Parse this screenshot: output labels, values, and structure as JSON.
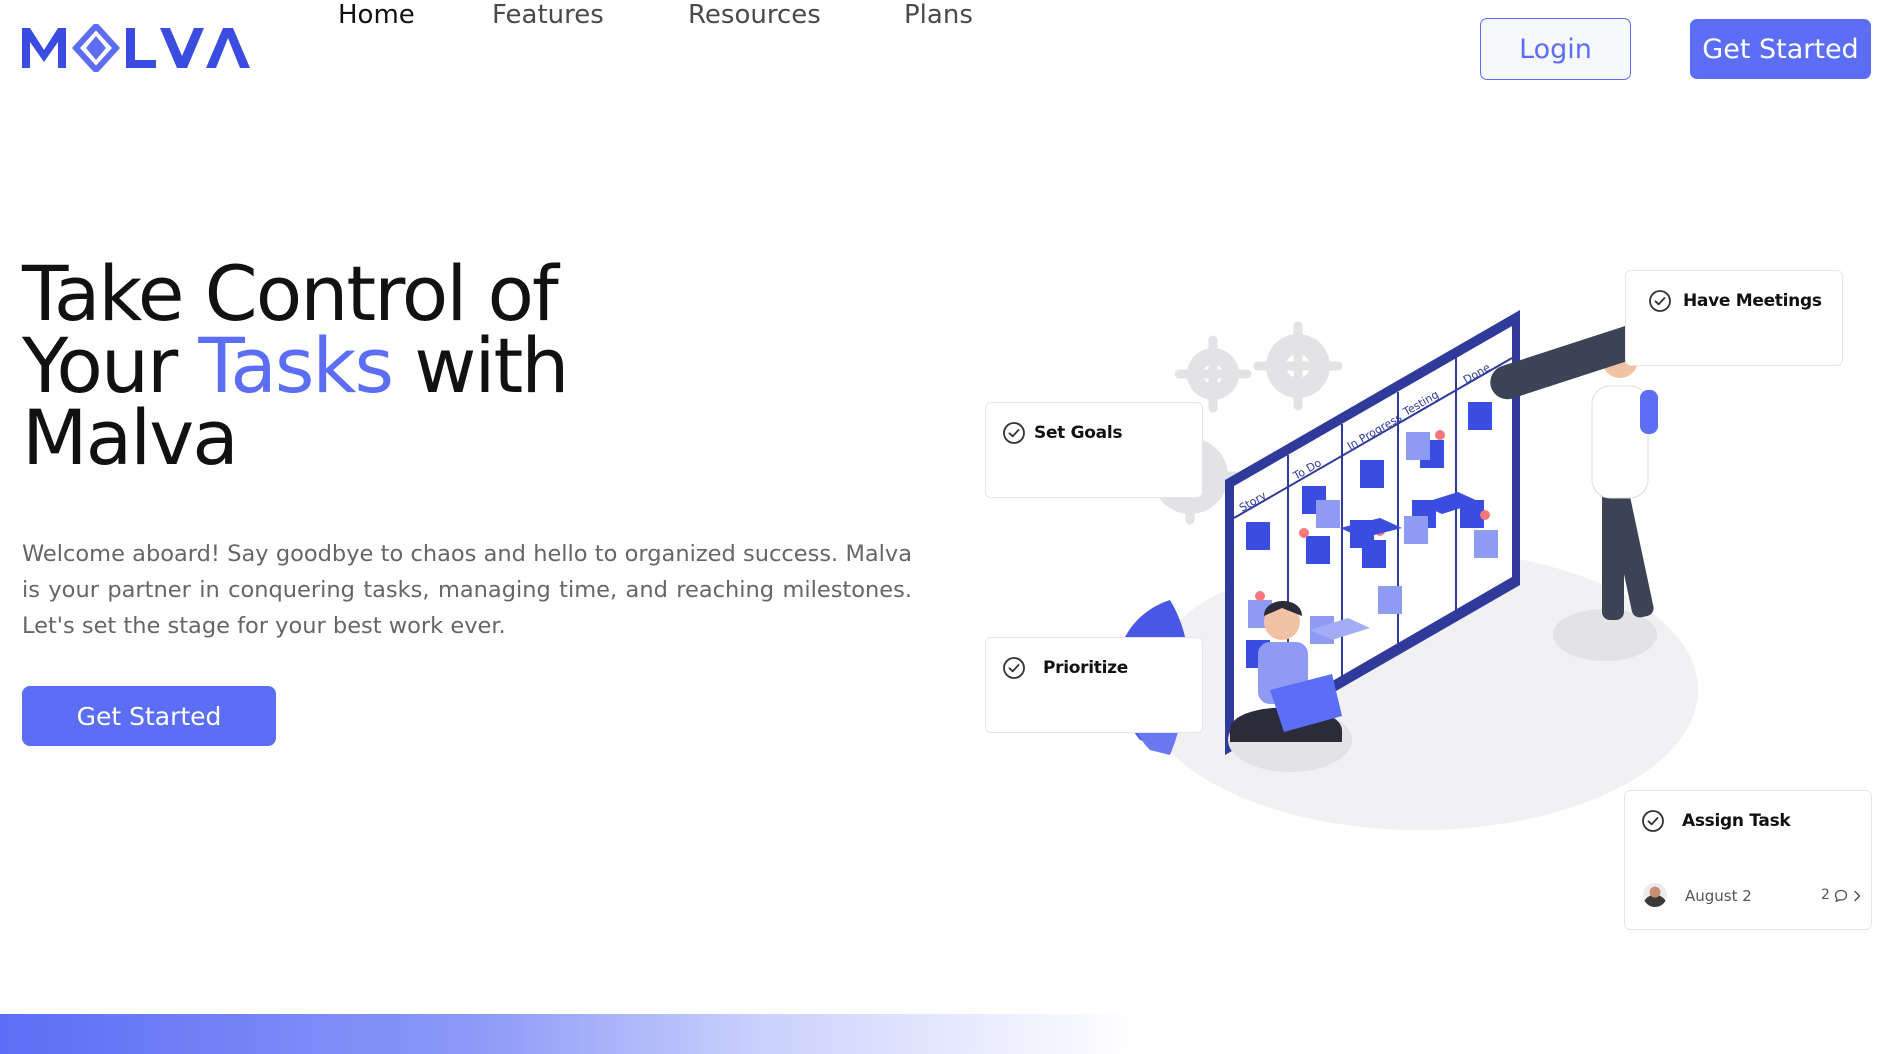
{
  "brand": {
    "name": "MALVA",
    "accent_color": "#5b6ef5"
  },
  "nav": {
    "items": [
      {
        "label": "Home",
        "active": true
      },
      {
        "label": "Features",
        "active": false
      },
      {
        "label": "Resources",
        "active": false
      },
      {
        "label": "Plans",
        "active": false
      }
    ],
    "login_label": "Login",
    "get_started_label": "Get Started"
  },
  "hero": {
    "title_line1": "Take Control of",
    "title_line2_start": "Your",
    "title_line2_accent": "Tasks",
    "title_line2_end": "with",
    "title_line3": "Malva",
    "description": "Welcome aboard! Say goodbye to chaos and hello to organized success. Malva is your partner in conquering tasks, managing time, and reaching milestones. Let's set the stage for your best work ever.",
    "cta_label": "Get Started"
  },
  "illustration": {
    "columns": [
      "Story",
      "To Do",
      "In Progress",
      "Testing",
      "Done"
    ]
  },
  "cards": {
    "have_meetings": "Have Meetings",
    "set_goals": "Set Goals",
    "prioritize": "Prioritize",
    "assign_task": "Assign Task",
    "assign_date": "August 2",
    "assign_comments": "2",
    "icons": [
      "check-circle-icon",
      "comment-icon",
      "chevron-right-icon"
    ]
  }
}
